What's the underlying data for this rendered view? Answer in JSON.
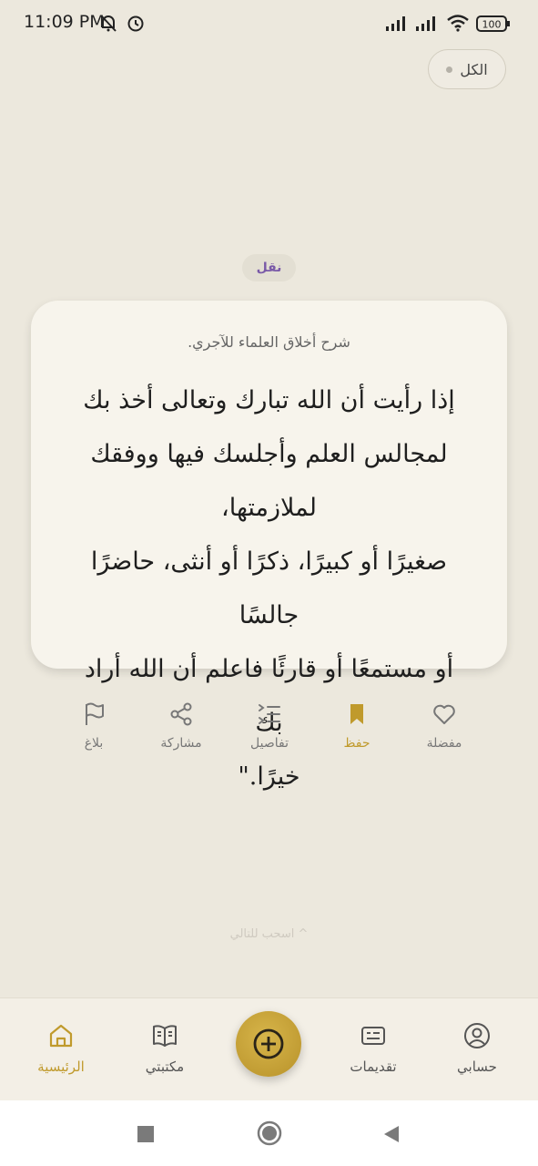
{
  "status": {
    "time": "11:09 PM",
    "battery": "100"
  },
  "filter": {
    "label": "الكل"
  },
  "tag": "نقل",
  "card": {
    "source": "شرح أخلاق العلماء للآجري.",
    "lines": [
      "إذا رأيت أن الله تبارك وتعالى أخذ بك",
      "لمجالس العلم وأجلسك فيها ووفقك لملازمتها،",
      "صغيرًا أو كبيرًا، ذكرًا أو أنثى، حاضرًا جالسًا",
      "أو مستمعًا أو قارئًا فاعلم أن الله أراد بك",
      "خيرًا.\""
    ]
  },
  "actions": {
    "favorite": "مفضلة",
    "save": "حفظ",
    "details": "تفاصيل",
    "share": "مشاركة",
    "report": "بلاغ"
  },
  "hint": "^ اسحب للتالي",
  "nav": {
    "account": "حسابي",
    "submissions": "تقديمات",
    "library": "مكتبتي",
    "home": "الرئيسية"
  },
  "colors": {
    "accent": "#C09A2C",
    "background": "#ECE8DD",
    "card": "#F7F4EC",
    "tag_text": "#7A5AA8"
  }
}
